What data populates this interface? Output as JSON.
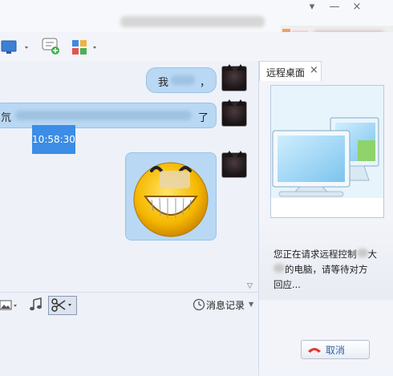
{
  "window": {
    "close_glyph": "×",
    "minimize_glyph": "—",
    "menu_glyph": "▾"
  },
  "chat": {
    "messages": [
      {
        "text": "我",
        "suffix": "，"
      },
      {
        "text": "氘",
        "end": "了"
      },
      {
        "time": "10:58:30"
      }
    ]
  },
  "input_toolbar": {
    "history_label": "消息记录"
  },
  "remote_panel": {
    "tab_label": "远程桌面",
    "tab_close": "×",
    "message_line1": "您正在请求远程控制",
    "message_line1_end": "大",
    "message_line2": "的电脑，请等待对方",
    "message_line3": "回应...",
    "cancel_label": "取消"
  },
  "colors": {
    "bubble": "#b8d8f4",
    "timestamp_bg": "#3b8de6",
    "accent_blue": "#2f86d6"
  },
  "icons": [
    "monitor-icon",
    "chat-add-icon",
    "apps-icon",
    "image-icon",
    "music-icon",
    "scissors-icon",
    "clock-icon",
    "remote-screen-icon",
    "hangup-icon"
  ]
}
